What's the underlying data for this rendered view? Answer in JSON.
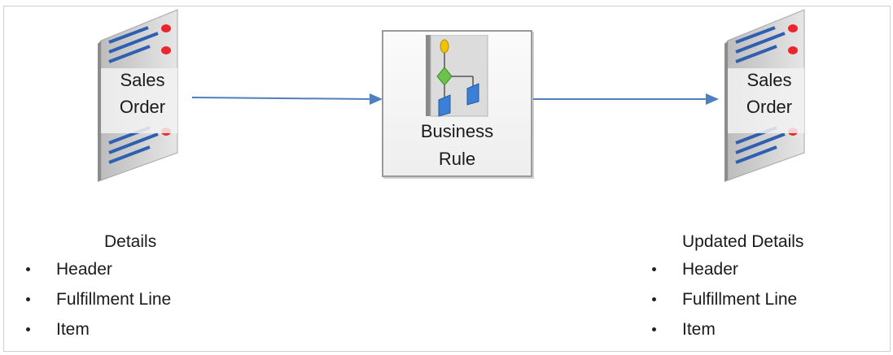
{
  "diagram": {
    "source_doc": {
      "line1": "Sales",
      "line2": "Order"
    },
    "process": {
      "line1": "Business",
      "line2": "Rule"
    },
    "target_doc": {
      "line1": "Sales",
      "line2": "Order"
    },
    "left_details": {
      "title": "Details",
      "items": [
        "Header",
        "Fulfillment Line",
        "Item"
      ]
    },
    "right_details": {
      "title": "Updated Details",
      "items": [
        "Header",
        "Fulfillment Line",
        "Item"
      ]
    },
    "colors": {
      "arrow": "#4f7fbf",
      "doc_face": "#d9d9d9",
      "doc_lines": "#2f5fb0",
      "doc_dots": "#e8262c",
      "rule_box_border": "#9a9a9a"
    }
  }
}
